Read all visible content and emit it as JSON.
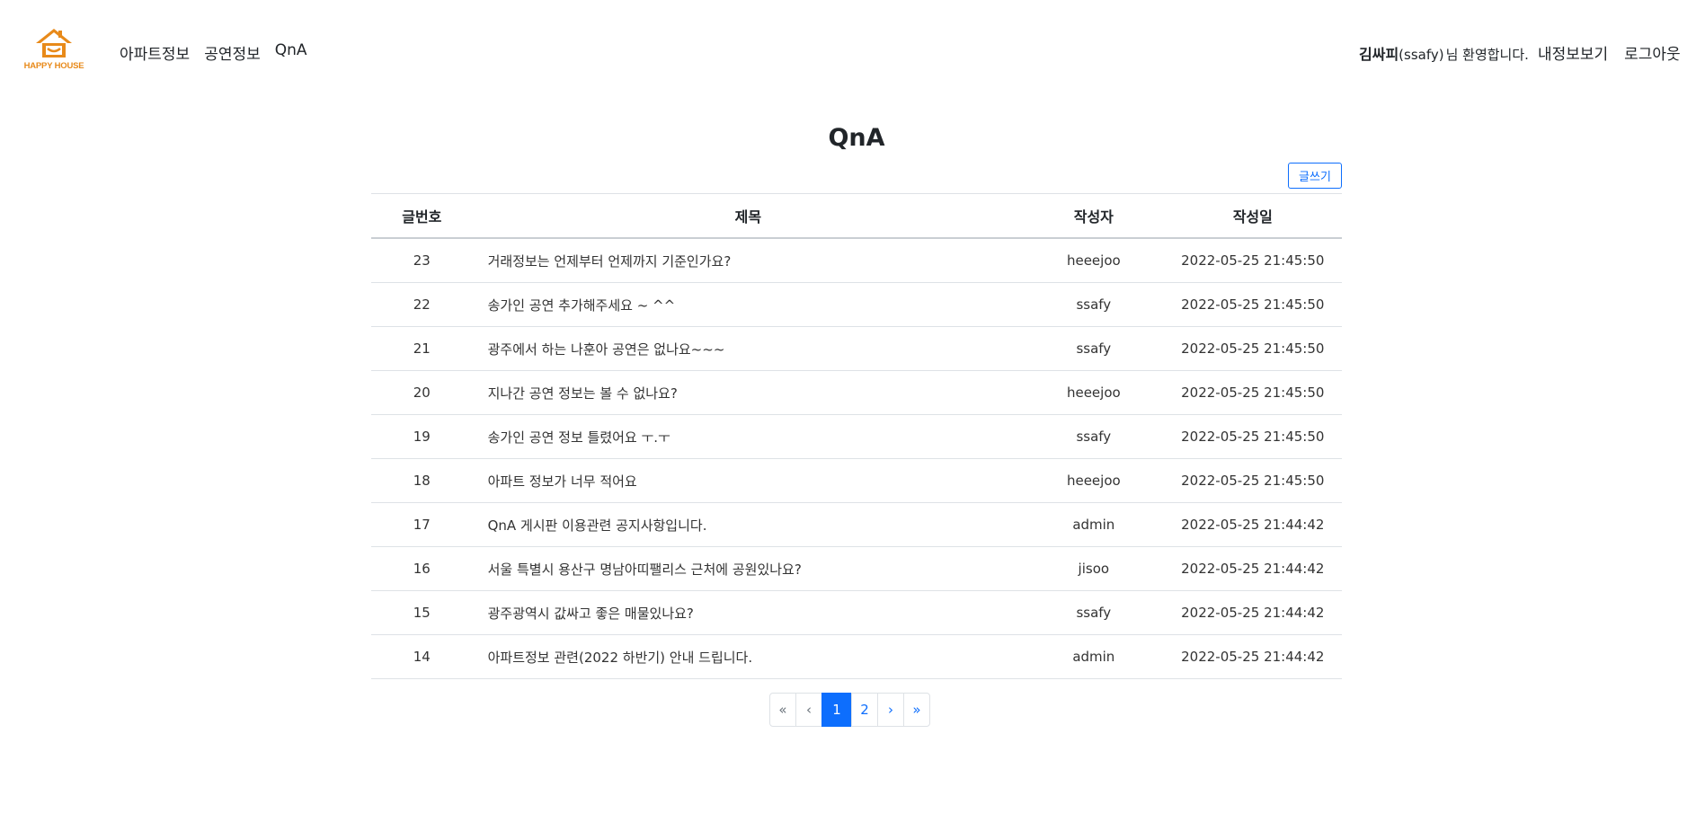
{
  "brand": {
    "name": "HAPPY HOUSE",
    "color": "#e88a1a"
  },
  "nav": {
    "items": [
      {
        "label": "아파트정보"
      },
      {
        "label": "공연정보"
      },
      {
        "label": "QnA"
      }
    ]
  },
  "user": {
    "name": "김싸피",
    "id": "(ssafy)",
    "welcome": "님 환영합니다.",
    "myinfo_label": "내정보보기",
    "logout_label": "로그아웃"
  },
  "page": {
    "title": "QnA",
    "write_label": "글쓰기"
  },
  "table": {
    "headers": {
      "no": "글번호",
      "title": "제목",
      "author": "작성자",
      "date": "작성일"
    },
    "rows": [
      {
        "no": "23",
        "title": "거래정보는 언제부터 언제까지 기준인가요?",
        "author": "heeejoo",
        "date": "2022-05-25 21:45:50"
      },
      {
        "no": "22",
        "title": "송가인 공연 추가해주세요 ~ ^^",
        "author": "ssafy",
        "date": "2022-05-25 21:45:50"
      },
      {
        "no": "21",
        "title": "광주에서 하는 나훈아 공연은 없나요~~~",
        "author": "ssafy",
        "date": "2022-05-25 21:45:50"
      },
      {
        "no": "20",
        "title": "지나간 공연 정보는 볼 수 없나요?",
        "author": "heeejoo",
        "date": "2022-05-25 21:45:50"
      },
      {
        "no": "19",
        "title": "송가인 공연 정보 틀렸어요 ㅜ.ㅜ",
        "author": "ssafy",
        "date": "2022-05-25 21:45:50"
      },
      {
        "no": "18",
        "title": "아파트 정보가 너무 적어요",
        "author": "heeejoo",
        "date": "2022-05-25 21:45:50"
      },
      {
        "no": "17",
        "title": "QnA 게시판 이용관련 공지사항입니다.",
        "author": "admin",
        "date": "2022-05-25 21:44:42"
      },
      {
        "no": "16",
        "title": "서울 특별시 용산구 명남아띠팰리스 근처에 공원있나요?",
        "author": "jisoo",
        "date": "2022-05-25 21:44:42"
      },
      {
        "no": "15",
        "title": "광주광역시 값싸고 좋은 매물있나요?",
        "author": "ssafy",
        "date": "2022-05-25 21:44:42"
      },
      {
        "no": "14",
        "title": "아파트정보 관련(2022 하반기) 안내 드립니다.",
        "author": "admin",
        "date": "2022-05-25 21:44:42"
      }
    ]
  },
  "pagination": {
    "items": [
      {
        "label": "«",
        "name": "page-first",
        "state": "disabled"
      },
      {
        "label": "‹",
        "name": "page-prev",
        "state": "disabled"
      },
      {
        "label": "1",
        "name": "page-1",
        "state": "active"
      },
      {
        "label": "2",
        "name": "page-2",
        "state": "normal"
      },
      {
        "label": "›",
        "name": "page-next",
        "state": "normal"
      },
      {
        "label": "»",
        "name": "page-last",
        "state": "normal"
      }
    ]
  },
  "colors": {
    "primary": "#0d6efd",
    "text": "#212529",
    "border": "#dee2e6"
  }
}
